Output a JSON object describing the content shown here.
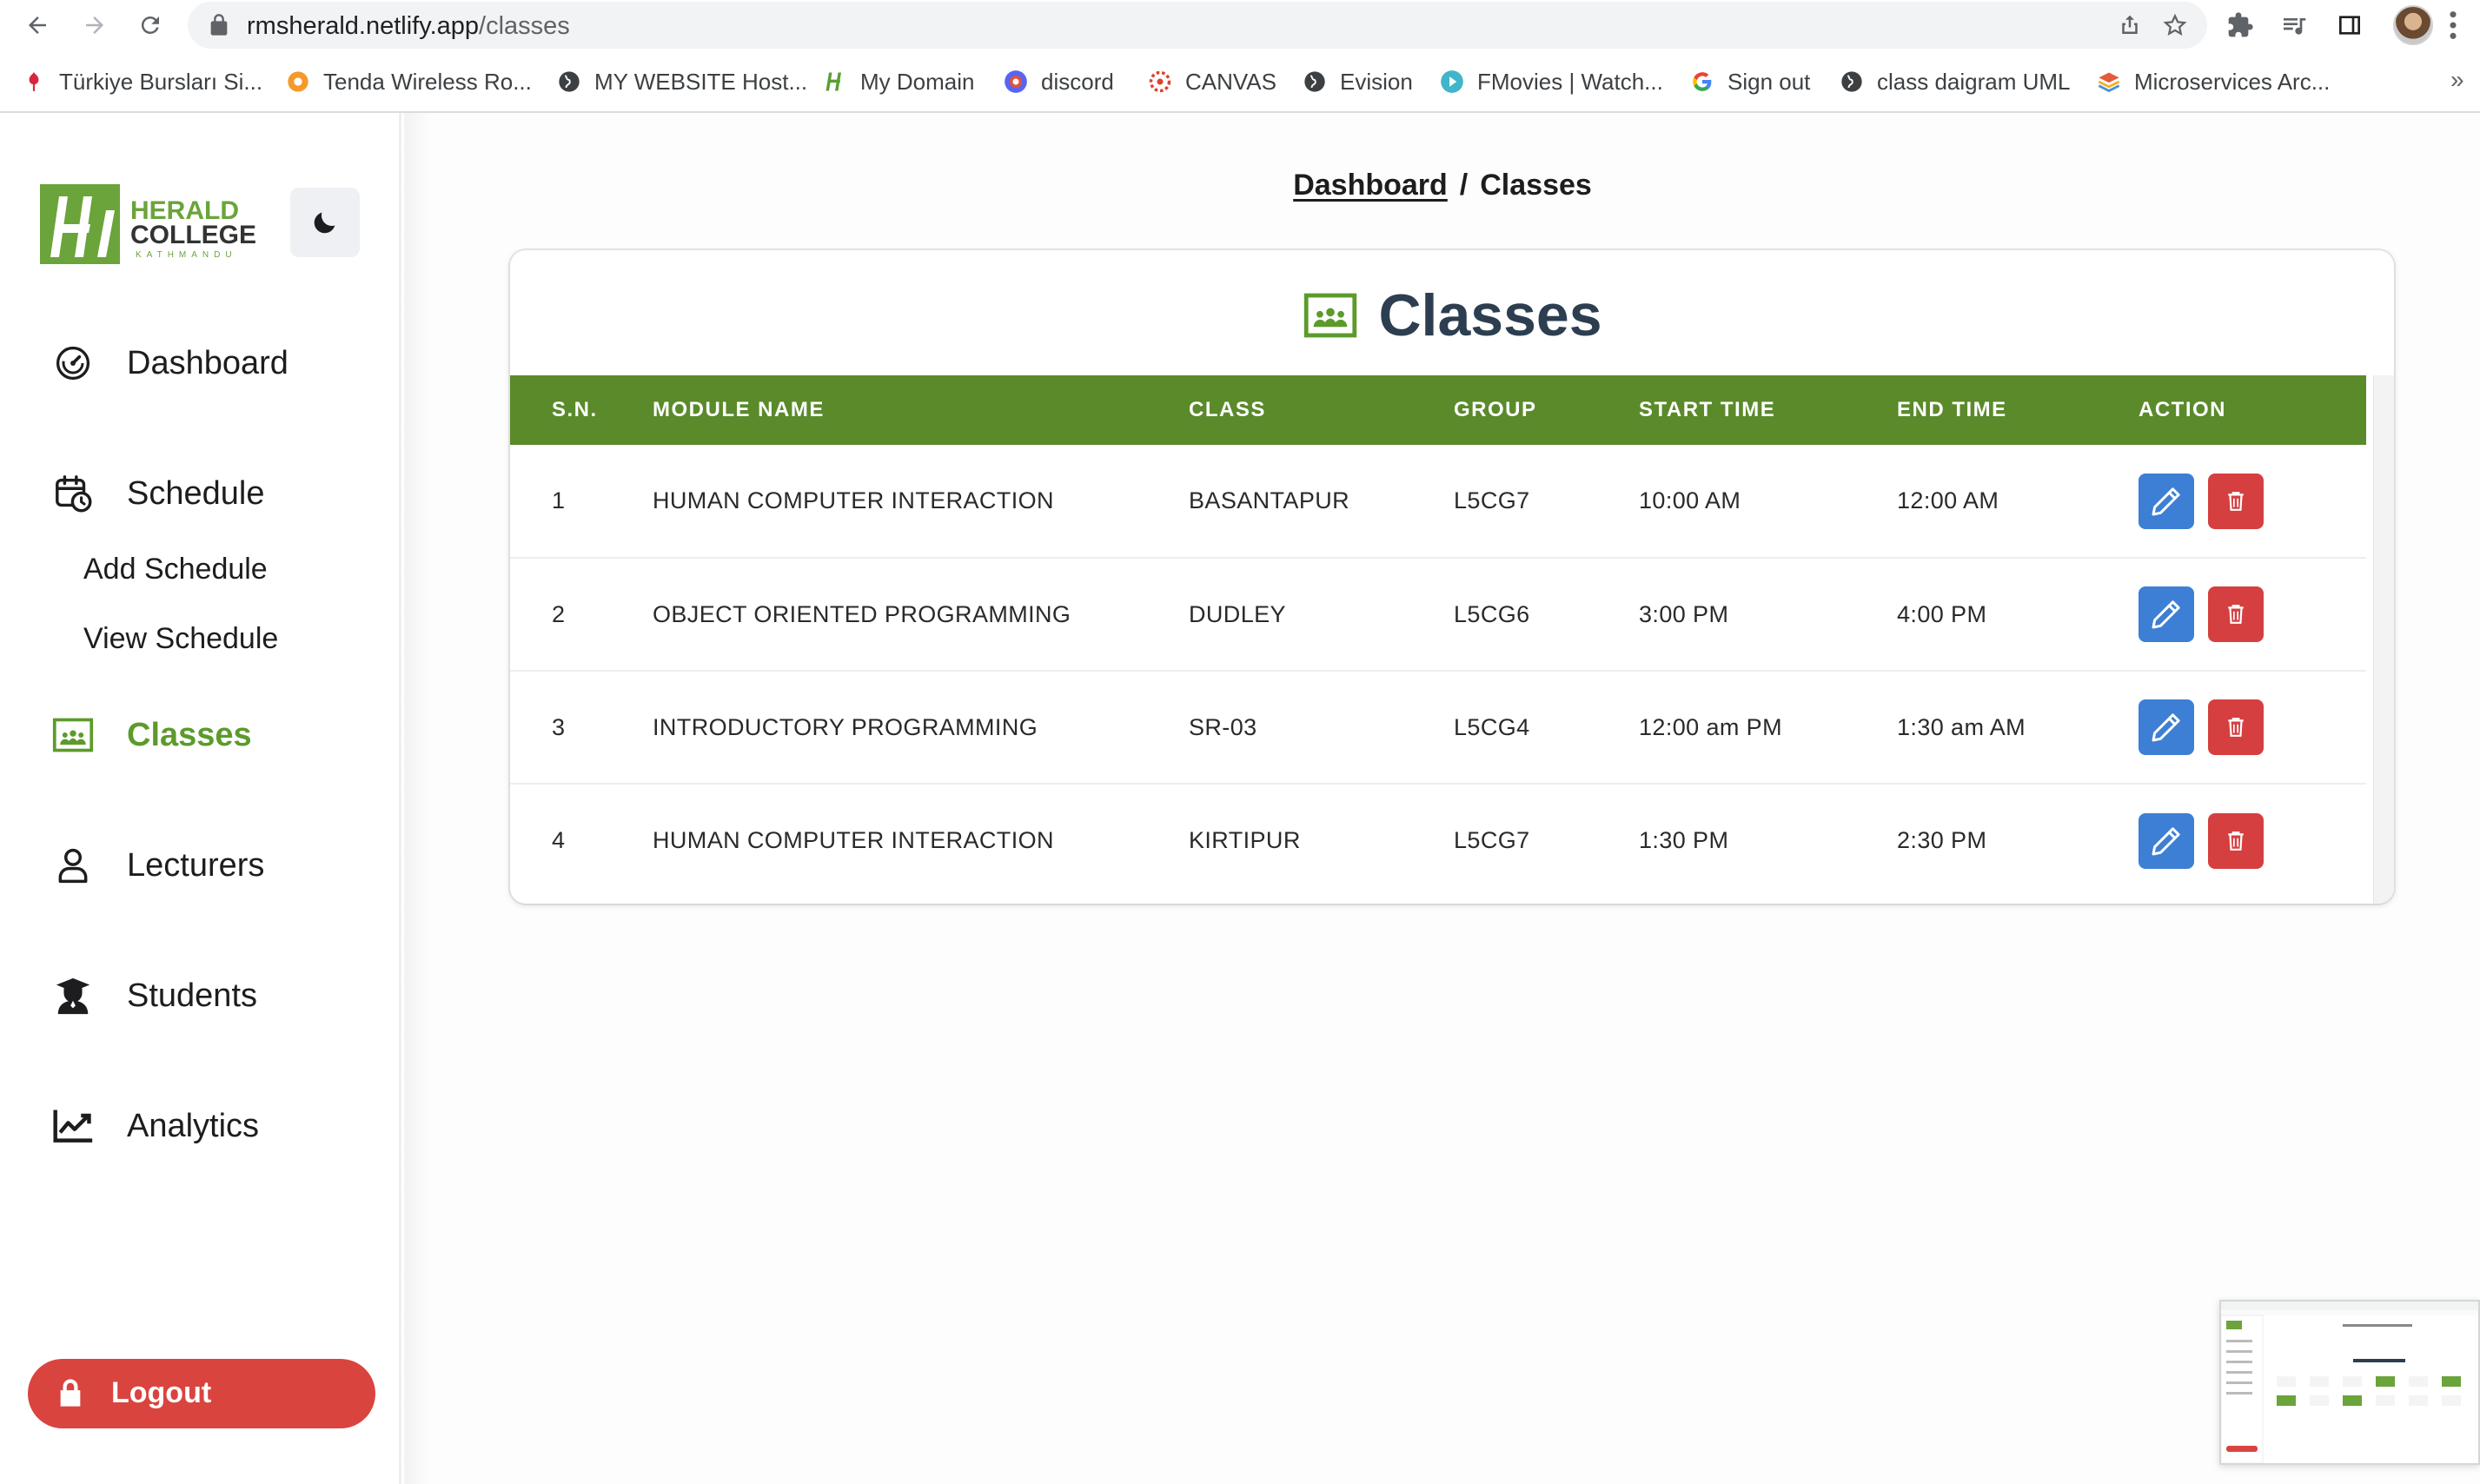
{
  "browser": {
    "url_host": "rmsherald.netlify.app",
    "url_path": "/classes",
    "bookmarks": [
      {
        "label": "Türkiye Bursları Si...",
        "icon": "tulip-icon"
      },
      {
        "label": "Tenda Wireless Ro...",
        "icon": "tenda-icon"
      },
      {
        "label": "MY WEBSITE Host...",
        "icon": "globe-icon"
      },
      {
        "label": "My Domain",
        "icon": "h-logo-icon"
      },
      {
        "label": "discord",
        "icon": "discord-icon"
      },
      {
        "label": "CANVAS",
        "icon": "canvas-icon"
      },
      {
        "label": "Evision",
        "icon": "globe-icon"
      },
      {
        "label": "FMovies | Watch...",
        "icon": "play-icon"
      },
      {
        "label": "Sign out",
        "icon": "google-icon"
      },
      {
        "label": "class daigram UML",
        "icon": "globe-icon"
      },
      {
        "label": "Microservices Arc...",
        "icon": "layers-icon"
      }
    ],
    "overflow": "»"
  },
  "sidebar": {
    "logo": {
      "line1": "HERALD",
      "line2": "COLLEGE",
      "line3": "KATHMANDU"
    },
    "items": [
      {
        "label": "Dashboard",
        "icon": "gauge-icon",
        "active": false
      },
      {
        "label": "Schedule",
        "icon": "calendar-clock-icon",
        "active": false
      },
      {
        "label": "Classes",
        "icon": "classroom-icon",
        "active": true
      },
      {
        "label": "Lecturers",
        "icon": "user-icon",
        "active": false
      },
      {
        "label": "Students",
        "icon": "graduate-icon",
        "active": false
      },
      {
        "label": "Analytics",
        "icon": "chart-line-icon",
        "active": false
      }
    ],
    "schedule_sub": [
      "Add Schedule",
      "View Schedule"
    ],
    "logout_label": "Logout"
  },
  "breadcrumb": {
    "home": "Dashboard",
    "separator": "/",
    "current": "Classes"
  },
  "card": {
    "title": "Classes",
    "columns": [
      "S.N.",
      "MODULE NAME",
      "CLASS",
      "GROUP",
      "START TIME",
      "END TIME",
      "ACTION"
    ],
    "rows": [
      {
        "sn": "1",
        "module": "HUMAN COMPUTER INTERACTION",
        "class": "BASANTAPUR",
        "group": "L5CG7",
        "start": "10:00 AM",
        "end": "12:00 AM"
      },
      {
        "sn": "2",
        "module": "OBJECT ORIENTED PROGRAMMING",
        "class": "DUDLEY",
        "group": "L5CG6",
        "start": "3:00 PM",
        "end": "4:00 PM"
      },
      {
        "sn": "3",
        "module": "INTRODUCTORY PROGRAMMING",
        "class": "SR-03",
        "group": "L5CG4",
        "start": "12:00 am PM",
        "end": "1:30 am AM"
      },
      {
        "sn": "4",
        "module": "HUMAN COMPUTER INTERACTION",
        "class": "KIRTIPUR",
        "group": "L5CG7",
        "start": "1:30 PM",
        "end": "2:30 PM"
      }
    ]
  },
  "colors": {
    "brand_green": "#5a8a2a",
    "active_green": "#5c9b2b",
    "edit_blue": "#3d7fd4",
    "delete_red": "#d63f3f",
    "logout_red": "#d9443f"
  }
}
